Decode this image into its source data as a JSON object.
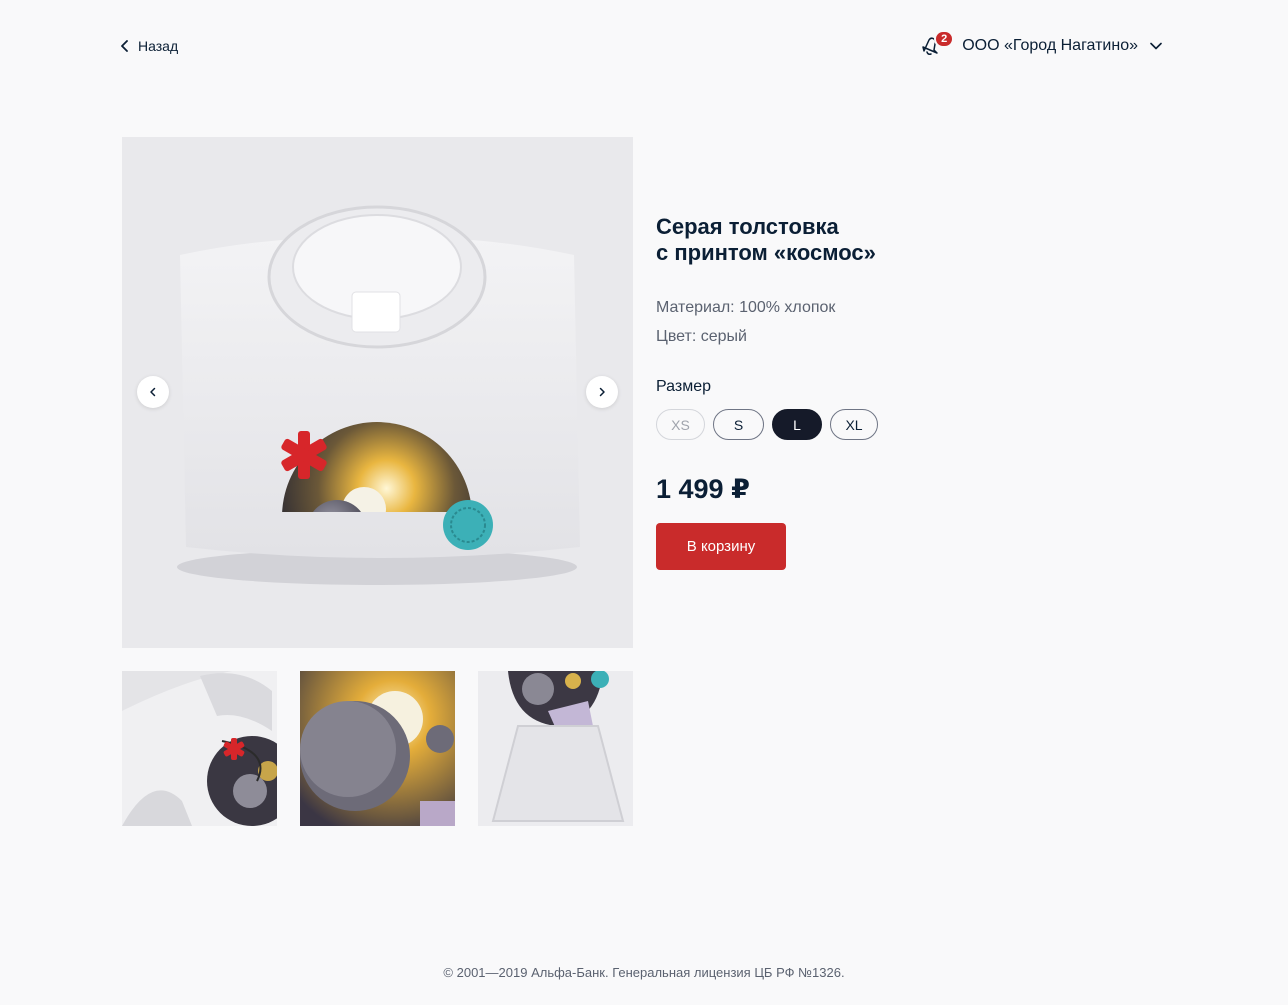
{
  "header": {
    "back_label": "Назад",
    "notifications_count": "2",
    "company_name": "ООО «Город Нагатино»"
  },
  "product": {
    "title": "Серая толстовка\nс принтом «космос»",
    "material": "Материал: 100% хлопок",
    "color": "Цвет: серый",
    "size_label": "Размер",
    "sizes": [
      {
        "label": "XS",
        "state": "disabled"
      },
      {
        "label": "S",
        "state": "available"
      },
      {
        "label": "L",
        "state": "selected"
      },
      {
        "label": "XL",
        "state": "available"
      }
    ],
    "price": "1 499 ₽",
    "cart_button": "В корзину"
  },
  "footer": {
    "text": "© 2001—2019 Альфа-Банк. Генеральная лицензия ЦБ РФ №1326."
  },
  "colors": {
    "accent": "#c92b2b",
    "selected_size": "#151a29",
    "text": "#0b1f35",
    "secondary_text": "#5b6270"
  }
}
